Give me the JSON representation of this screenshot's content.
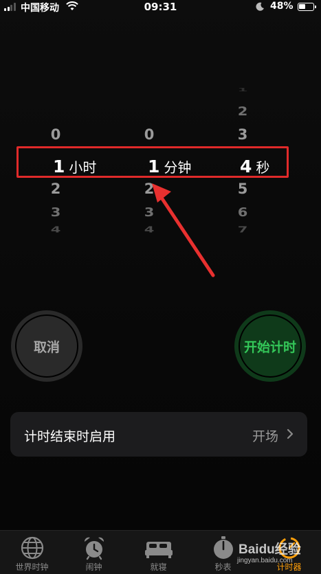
{
  "status_bar": {
    "carrier": "中国移动",
    "time": "09:31",
    "battery_percent": "48%",
    "battery_level": 0.48,
    "icons": [
      "signal-icon",
      "wifi-icon",
      "moon-icon",
      "battery-icon"
    ]
  },
  "picker": {
    "hours": {
      "above": [
        "0"
      ],
      "selected": "1",
      "unit": "小时",
      "below": [
        "2",
        "3",
        "4"
      ]
    },
    "minutes": {
      "above": [
        "0"
      ],
      "selected": "1",
      "unit": "分钟",
      "below": [
        "2",
        "3",
        "4"
      ]
    },
    "seconds": {
      "above": [
        "1",
        "2",
        "3"
      ],
      "selected": "4",
      "unit": "秒",
      "below": [
        "5",
        "6",
        "7"
      ]
    }
  },
  "annotation": {
    "highlight_color": "#e02a2a",
    "arrow_color": "#e8302f"
  },
  "buttons": {
    "cancel": "取消",
    "start": "开始计时",
    "start_color": "#34c759"
  },
  "setting": {
    "label": "计时结束时启用",
    "value": "开场"
  },
  "tabs": [
    {
      "label": "世界时钟",
      "icon": "globe-icon"
    },
    {
      "label": "闹钟",
      "icon": "alarm-clock-icon"
    },
    {
      "label": "就寝",
      "icon": "bed-icon"
    },
    {
      "label": "秒表",
      "icon": "stopwatch-icon"
    },
    {
      "label": "计时器",
      "icon": "timer-icon",
      "active": true
    }
  ],
  "watermark": {
    "text": "Baidu经验",
    "sub": "jingyan.baidu.com"
  },
  "colors": {
    "accent": "#ff9f0a",
    "background": "#000000"
  }
}
